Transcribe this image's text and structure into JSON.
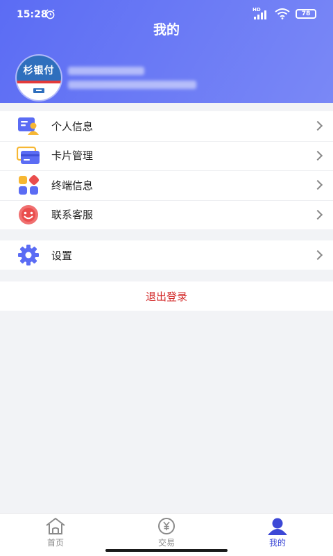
{
  "status_bar": {
    "time": "15:28",
    "signal_label": "HD",
    "battery": "78"
  },
  "header": {
    "title": "我的"
  },
  "profile": {
    "avatar_logo_text": "杉银付"
  },
  "menu": {
    "items": [
      {
        "label": "个人信息",
        "icon": "id-card-icon"
      },
      {
        "label": "卡片管理",
        "icon": "card-icon"
      },
      {
        "label": "终端信息",
        "icon": "terminal-apps-icon"
      },
      {
        "label": "联系客服",
        "icon": "smile-service-icon"
      }
    ],
    "settings": {
      "label": "设置",
      "icon": "gear-icon"
    }
  },
  "logout": {
    "label": "退出登录"
  },
  "tabbar": {
    "items": [
      {
        "label": "首页",
        "icon": "home-icon",
        "active": false
      },
      {
        "label": "交易",
        "icon": "yen-coin-icon",
        "active": false
      },
      {
        "label": "我的",
        "icon": "user-icon",
        "active": true
      }
    ]
  },
  "colors": {
    "header_gradient_start": "#5b6cf4",
    "header_gradient_end": "#7a88f6",
    "logout_red": "#d32a2a",
    "tab_active": "#3c48d6",
    "background": "#f2f3f6"
  }
}
